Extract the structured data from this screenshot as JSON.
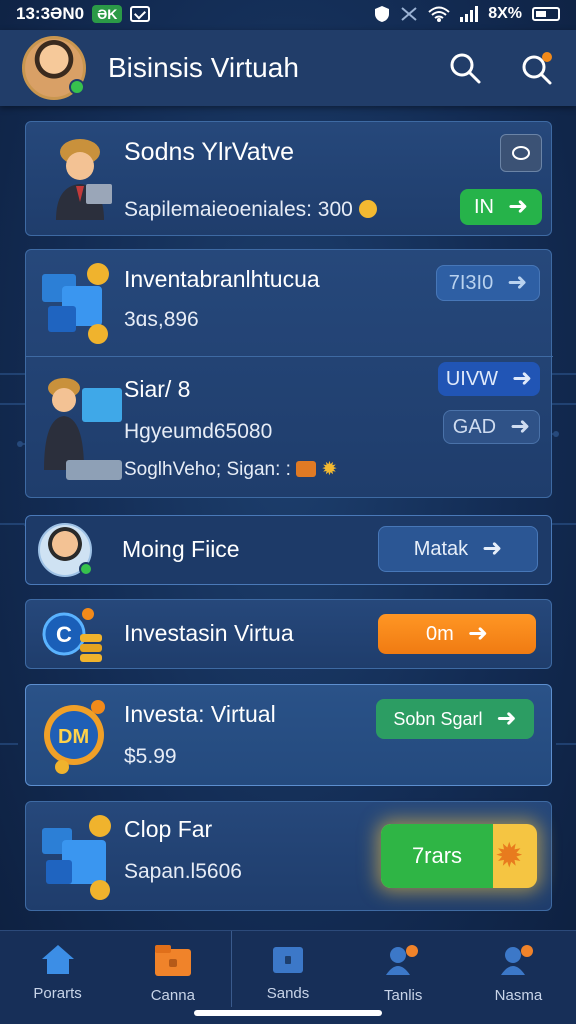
{
  "status_bar": {
    "time": "13:3ƏN0",
    "pill": "ƏK",
    "battery_text": "8X%"
  },
  "header": {
    "title": "Bisinsis Virtuah"
  },
  "cards": [
    {
      "title": "Sodns YlrVatve",
      "subtitle": "Sapilemaieoeniales: 300",
      "button_label": "IN"
    },
    {
      "title": "Inventabranlhtucua",
      "subtitle": "3ɑs,896",
      "button_label": "7I3I0"
    },
    {
      "title": "Siar/ 8",
      "subtitle": "Hgyeumd65080",
      "subtitle2": "SoglhVeho; Sigan: :",
      "button_label": "UIVW",
      "button2_label": "GAD"
    },
    {
      "title": "Moing Fiice",
      "button_label": "Matak"
    },
    {
      "title": "Investasin Virtua",
      "button_label": "0m"
    },
    {
      "title": "Investa: Virtual",
      "subtitle": "$5.99",
      "button_label": "Sobn Sgarl"
    },
    {
      "title": "Clop Far",
      "subtitle": "Sapan.l5606",
      "button_label": "7rars"
    }
  ],
  "nav": [
    {
      "label": "Porarts",
      "icon": "home-icon"
    },
    {
      "label": "Canna",
      "icon": "folder-icon"
    },
    {
      "label": "Sands",
      "icon": "wallet-icon"
    },
    {
      "label": "Tanlis",
      "icon": "people-icon"
    },
    {
      "label": "Nasma",
      "icon": "people-icon"
    }
  ],
  "colors": {
    "background": "#132c54",
    "header": "#213d69",
    "card": "#24467a",
    "green": "#26b34a",
    "orange": "#f28a1a",
    "teal": "#2c9d63"
  }
}
